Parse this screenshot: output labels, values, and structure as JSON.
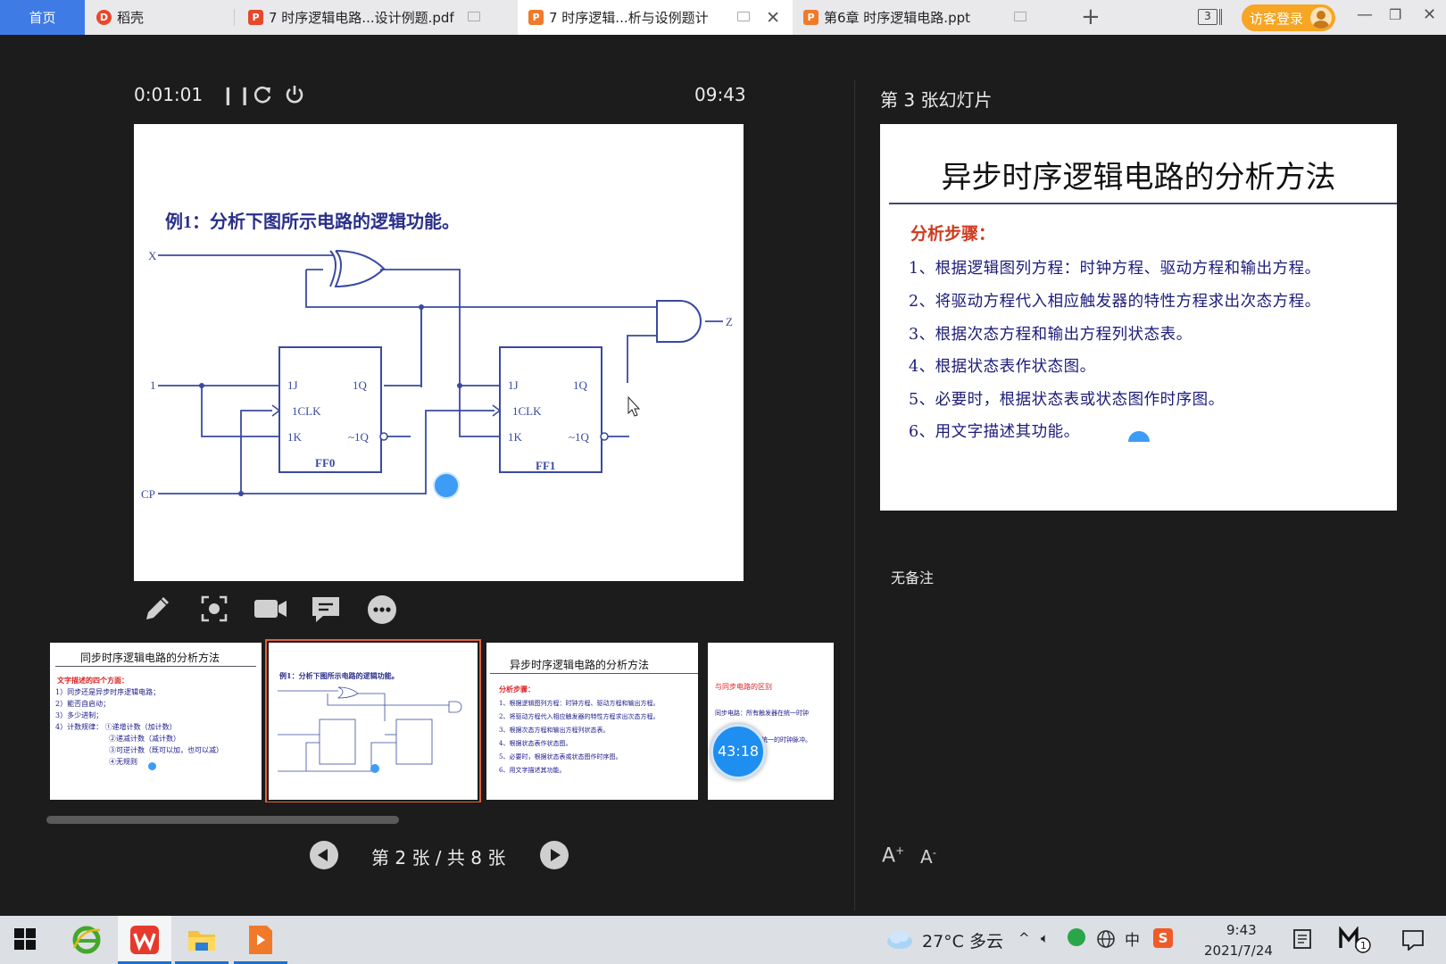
{
  "tabs": {
    "home": "首页",
    "items": [
      {
        "label": "稻壳",
        "icon_color": "#e8472c",
        "icon": "daoke-icon"
      },
      {
        "label": "7 时序逻辑电路...设计例题.pdf",
        "icon_color": "#e8472c",
        "icon": "pdf-icon"
      },
      {
        "label": "7 时序逻辑...析与设例题计",
        "icon_color": "#f07a2a",
        "icon": "ppt-icon"
      },
      {
        "label": "第6章 时序逻辑电路.ppt",
        "icon_color": "#f07a2a",
        "icon": "ppt-icon"
      }
    ],
    "window_count": "3",
    "login": "访客登录"
  },
  "presenter": {
    "elapsed": "0:01:01",
    "clock": "09:43",
    "page_info": "第 2 张 / 共 8 张",
    "next_label": "第 3 张幻灯片",
    "notes": "无备注",
    "float_timer": "43:18"
  },
  "current_slide": {
    "title": "例1：分析下图所示电路的逻辑功能。",
    "labels": {
      "x": "X",
      "z": "Z",
      "one": "1",
      "cp": "CP",
      "j": "1J",
      "q": "1Q",
      "clk": "1CLK",
      "k": "1K",
      "nq": "~1Q",
      "ff0": "FF0",
      "ff1": "FF1"
    }
  },
  "next_slide": {
    "title": "异步时序逻辑电路的分析方法",
    "steps_label": "分析步骤：",
    "steps": [
      "1、根据逻辑图列方程：时钟方程、驱动方程和输出方程。",
      "2、将驱动方程代入相应触发器的特性方程求出次态方程。",
      "3、根据次态方程和输出方程列状态表。",
      "4、根据状态表作状态图。",
      "5、必要时，根据状态表或状态图作时序图。",
      "6、用文字描述其功能。"
    ]
  },
  "thumbnails": [
    {
      "title": "同步时序逻辑电路的分析方法",
      "red": "文字描述的四个方面：",
      "lines": [
        "1）同步还是异步时序逻辑电路；",
        "2）能否自启动；",
        "3）多少进制；",
        "4）计数规律：  ①递增计数（加计数）",
        "②递减计数（减计数）",
        "③可逆计数（既可以加，也可以减）",
        "④无规则"
      ]
    },
    {
      "title": "例1：分析下图所示电路的逻辑功能。"
    },
    {
      "title": "异步时序逻辑电路的分析方法",
      "red": "分析步骤：",
      "lines": [
        "1、根据逻辑图列方程：时钟方程、驱动方程和输出方程。",
        "2、将驱动方程代入相应触发器的特性方程求出次态方程。",
        "3、根据次态方程和输出方程列状态表。",
        "4、根据状态表作状态图。",
        "5、必要时，根据状态表或状态图作时序图。",
        "6、用文字描述其功能。"
      ]
    },
    {
      "title": "与同步电路的区别",
      "lines": [
        "同步电路：所有触发器在统一时钟",
        "统一的时钟脉冲。"
      ]
    }
  ],
  "taskbar": {
    "weather": "27°C 多云",
    "ime": "中",
    "time": "9:43",
    "date": "2021/7/24"
  }
}
